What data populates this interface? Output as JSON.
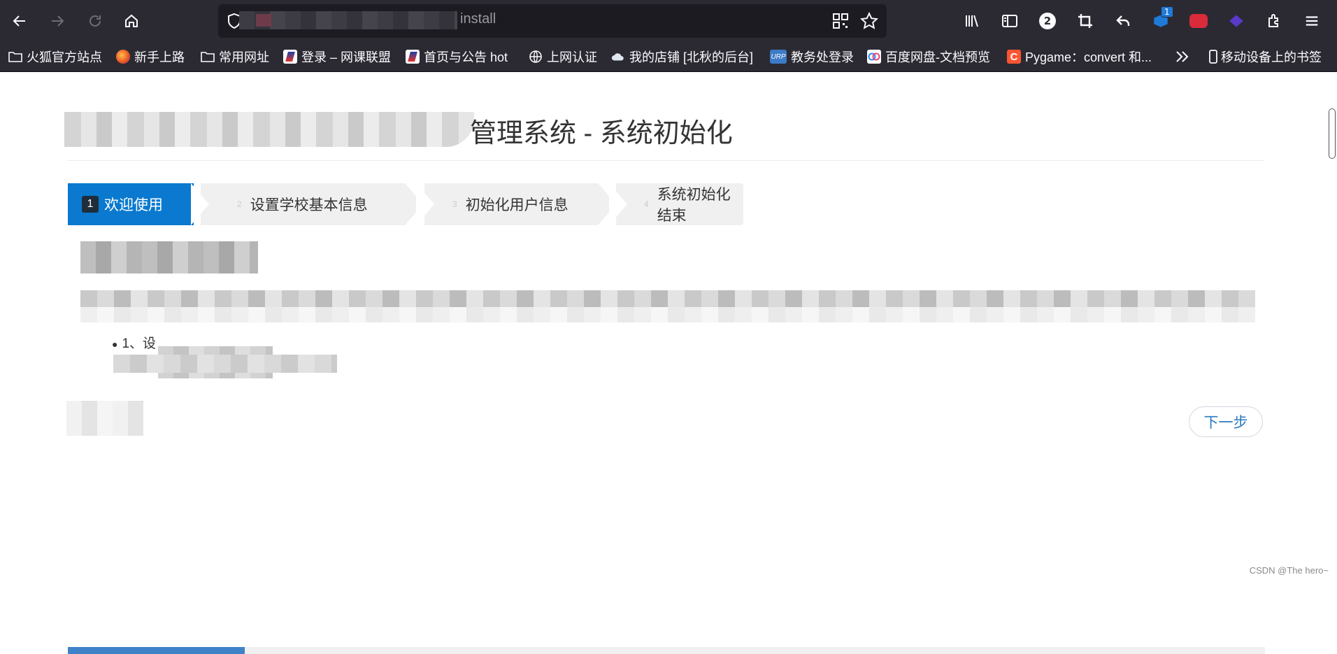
{
  "browser": {
    "url_visible_text": "install",
    "badges": {
      "tab_count": "2",
      "extension_count": "1"
    }
  },
  "bookmarks": [
    {
      "label": "火狐官方站点",
      "icon": "folder-icon"
    },
    {
      "label": "新手上路",
      "icon": "firefox-icon"
    },
    {
      "label": "常用网址",
      "icon": "folder-icon"
    },
    {
      "label": "登录 – 网课联盟",
      "icon": "site-icon"
    },
    {
      "label": "首页与公告 hot",
      "icon": "site-icon"
    },
    {
      "label": "上网认证",
      "icon": "globe-icon"
    },
    {
      "label": "我的店铺 [北秋的后台]",
      "icon": "cloud-icon"
    },
    {
      "label": "教务处登录",
      "icon": "urp-icon",
      "icon_text": "URP"
    },
    {
      "label": "百度网盘-文档预览",
      "icon": "baidu-icon"
    },
    {
      "label": "Pygame：convert 和...",
      "icon": "csdn-icon",
      "icon_text": "C"
    },
    {
      "label": "移动设备上的书签",
      "icon": "mobile-icon"
    }
  ],
  "page": {
    "title": "管理系统 - 系统初始化",
    "steps": [
      {
        "num": "1",
        "label": "欢迎使用",
        "active": true
      },
      {
        "num": "2",
        "label": "设置学校基本信息",
        "active": false
      },
      {
        "num": "3",
        "label": "初始化用户信息",
        "active": false
      },
      {
        "num": "4",
        "label": "系统初始化结束",
        "active": false
      }
    ],
    "list_item_visible": "1、设",
    "next_button": "下一步",
    "progress_fraction": 0.148
  },
  "watermark": "CSDN @The hero~",
  "colors": {
    "chrome_bg": "#2b2a33",
    "urlbar_bg": "#1c1b22",
    "step_active": "#0a79cf",
    "step_inactive": "#f0f0f0",
    "button_text": "#2a79c0",
    "progress": "#3f82c8"
  }
}
